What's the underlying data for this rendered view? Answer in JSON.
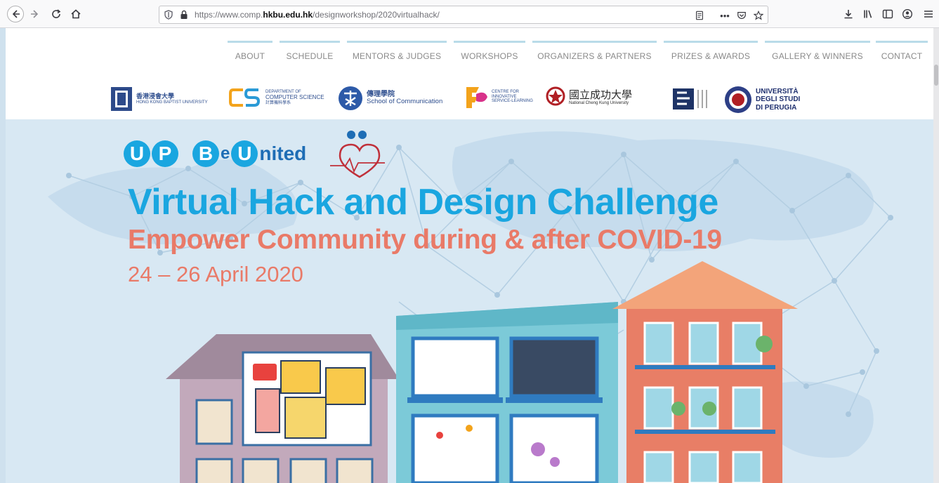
{
  "browser": {
    "url_prefix": "https://www.comp.",
    "url_domain": "hkbu.edu.hk",
    "url_path": "/designworkshop/2020virtualhack/",
    "icons": [
      "back-icon",
      "forward-icon",
      "reload-icon",
      "home-icon",
      "shield-icon",
      "lock-icon",
      "reader-view-icon",
      "more-icon",
      "pocket-icon",
      "bookmark-star-icon",
      "download-icon",
      "library-icon",
      "sidebar-icon",
      "account-icon",
      "menu-icon"
    ]
  },
  "nav": {
    "items": [
      "ABOUT",
      "SCHEDULE",
      "MENTORS & JUDGES",
      "WORKSHOPS",
      "ORGANIZERS & PARTNERS",
      "PRIZES & AWARDS",
      "GALLERY & WINNERS",
      "CONTACT"
    ]
  },
  "logos": {
    "hkbu_cn": "香港浸會大學",
    "hkbu_en": "HONG KONG BAPTIST UNIVERSITY",
    "cs_line1": "DEPARTMENT OF",
    "cs_line2": "COMPUTER SCIENCE",
    "cs_cn": "計算機科學系",
    "comm_cn": "傳理學院",
    "comm_en": "School of Communication",
    "csil_line1": "CENTRE FOR",
    "csil_line2": "INNOVATIVE",
    "csil_line3": "SERVICE-LEARNING",
    "ncku_cn": "國立成功大學",
    "ncku_en": "National Cheng Kung University",
    "perugia_line1": "UNIVERSITÀ",
    "perugia_line2": "DEGLI STUDI",
    "perugia_line3": "DI PERUGIA"
  },
  "hero": {
    "up_letters": [
      "U",
      "P"
    ],
    "be_letter": "B",
    "united_prefix": "e",
    "united_u": "U",
    "united_suffix": "nited",
    "title": "Virtual Hack and Design Challenge",
    "subtitle": "Empower Community during & after COVID-19",
    "date": "24 – 26 April 2020"
  },
  "colors": {
    "accent_blue": "#1aa6e0",
    "accent_coral": "#e97a68",
    "hero_bg": "#d8e8f3",
    "nav_line": "#b9dbe9"
  }
}
